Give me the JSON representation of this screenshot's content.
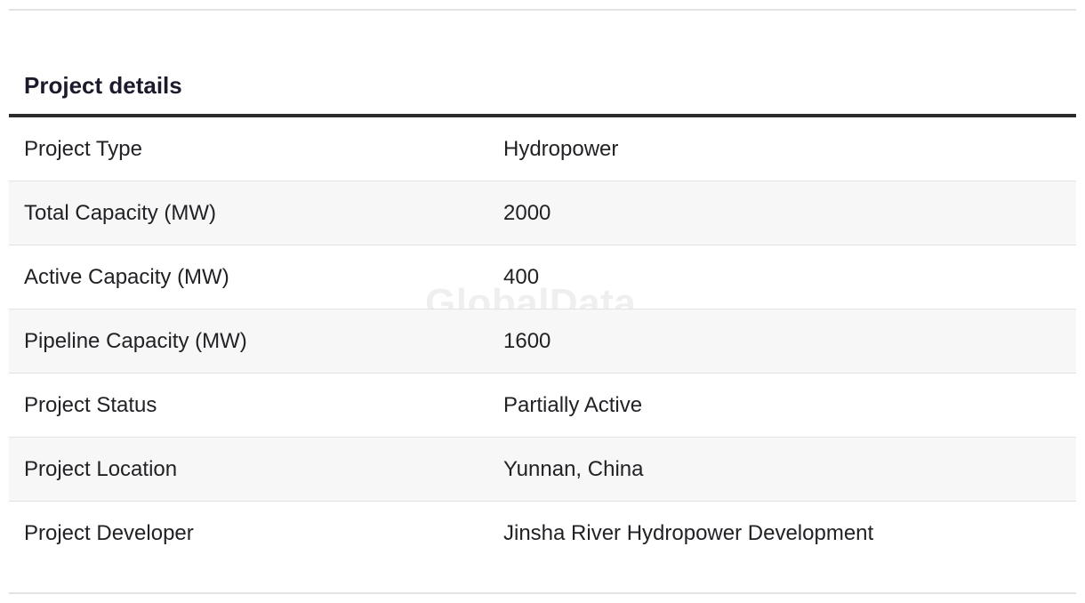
{
  "section": {
    "title": "Project details"
  },
  "watermark": "GlobalData",
  "rows": [
    {
      "label": "Project Type",
      "value": "Hydropower"
    },
    {
      "label": "Total Capacity (MW)",
      "value": "2000"
    },
    {
      "label": "Active Capacity (MW)",
      "value": "400"
    },
    {
      "label": "Pipeline Capacity (MW)",
      "value": "1600"
    },
    {
      "label": "Project Status",
      "value": "Partially Active"
    },
    {
      "label": "Project Location",
      "value": "Yunnan, China"
    },
    {
      "label": "Project Developer",
      "value": "Jinsha River Hydropower Development"
    }
  ],
  "colors": {
    "header_rule": "#2b2b2e",
    "alt_row": "#f7f7f7",
    "divider": "#e3e3e3",
    "title": "#1c1b2b"
  }
}
